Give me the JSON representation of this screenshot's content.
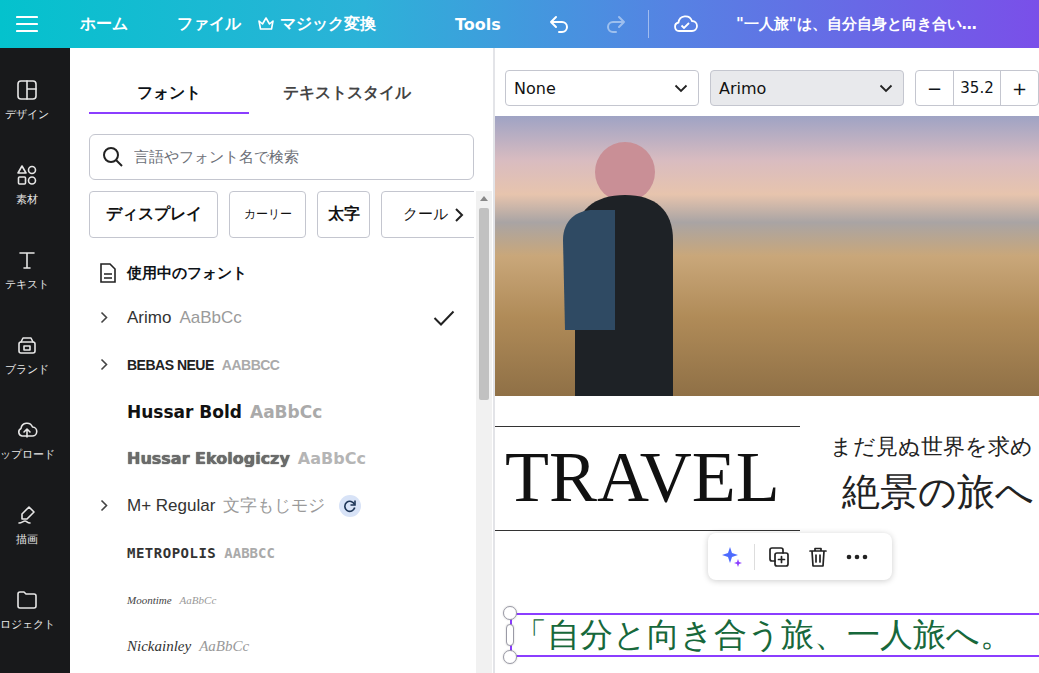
{
  "topbar": {
    "items": [
      {
        "label": "ホーム"
      },
      {
        "label": "ファイル"
      },
      {
        "label": "マジック変換"
      },
      {
        "label": "Tools"
      }
    ],
    "undo": {
      "disabled": false
    },
    "redo": {
      "disabled": true
    },
    "title": "\"一人旅\"は、自分自身と向き合い…"
  },
  "rail": [
    {
      "label": "デザイン"
    },
    {
      "label": "素材"
    },
    {
      "label": "テキスト"
    },
    {
      "label": "ブランド"
    },
    {
      "label": "ップロード"
    },
    {
      "label": "描画"
    },
    {
      "label": "ロジェクト"
    }
  ],
  "panel": {
    "tabs": [
      {
        "label": "フォント",
        "selected": true
      },
      {
        "label": "テキストスタイル",
        "selected": false
      }
    ],
    "search": {
      "placeholder": "言語やフォント名で検索"
    },
    "chips": [
      {
        "label": "ディスプレイ",
        "kind": "heavy"
      },
      {
        "label": "カーリー",
        "kind": "light"
      },
      {
        "label": "太字",
        "kind": "bold"
      },
      {
        "label": "クール",
        "kind": "plain"
      }
    ],
    "section": "使用中のフォント",
    "fonts": [
      {
        "name": "Arimo",
        "sample": "AaBbCc",
        "kind": "sans",
        "expandable": true,
        "checked": true,
        "updating": false
      },
      {
        "name": "BEBAS NEUE",
        "sample": "AABBCC",
        "kind": "condensed",
        "expandable": true,
        "checked": false,
        "updating": false
      },
      {
        "name": "Hussar Bold",
        "sample": "AaBbCc",
        "kind": "heavy",
        "expandable": false,
        "checked": false,
        "updating": false
      },
      {
        "name": "Hussar Ekologiczy",
        "sample": "AaBbCc",
        "kind": "outline",
        "expandable": false,
        "checked": false,
        "updating": false
      },
      {
        "name": "M+ Regular",
        "sample": "文字もじモジ",
        "kind": "sans",
        "expandable": true,
        "checked": false,
        "updating": true
      },
      {
        "name": "METROPOLIS",
        "sample": "AABBCC",
        "kind": "stencil",
        "expandable": false,
        "checked": false,
        "updating": false
      },
      {
        "name": "Moontime",
        "sample": "AaBbCc",
        "kind": "script",
        "expandable": false,
        "checked": false,
        "updating": false
      },
      {
        "name": "Nickainley",
        "sample": "AaBbCc",
        "kind": "brush",
        "expandable": false,
        "checked": false,
        "updating": false
      }
    ]
  },
  "toolbar": {
    "effect": "None",
    "font": "Arimo",
    "size": "35.2",
    "minus": "−",
    "plus": "+"
  },
  "canvas": {
    "heading": "TRAVEL",
    "tagline": "まだ見ぬ世界を求め",
    "title": "絶景の旅へ",
    "quote": "「自分と向き合う旅、一人旅へ。",
    "quote_selected": true
  }
}
